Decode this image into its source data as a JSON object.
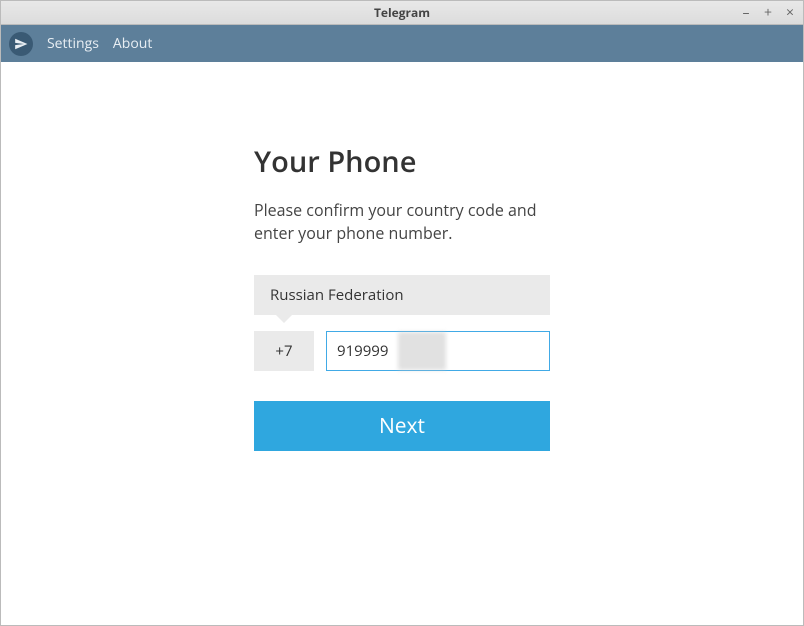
{
  "window": {
    "title": "Telegram"
  },
  "menubar": {
    "settings": "Settings",
    "about": "About"
  },
  "form": {
    "heading": "Your Phone",
    "subtext": "Please confirm your country code and enter your phone number.",
    "country": "Russian Federation",
    "country_code": "+7",
    "phone_value": "919999",
    "next_label": "Next"
  }
}
